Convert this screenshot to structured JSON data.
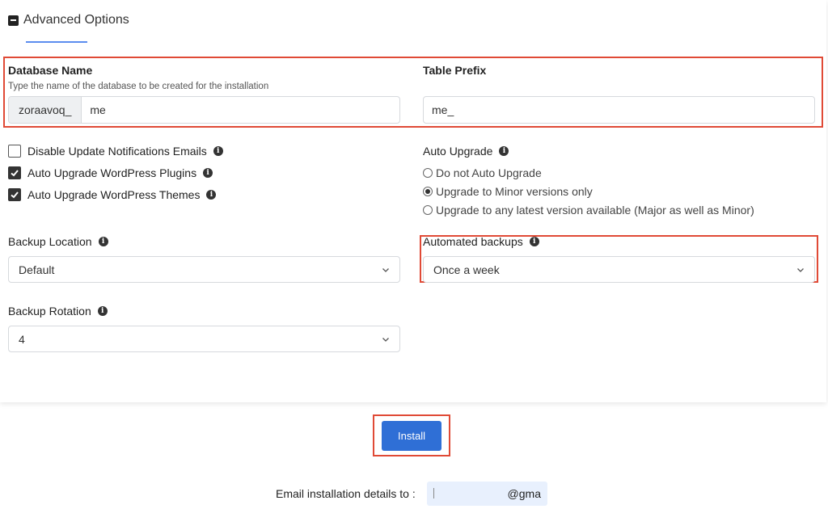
{
  "section": {
    "title": "Advanced Options"
  },
  "database": {
    "label": "Database Name",
    "help": "Type the name of the database to be created for the installation",
    "prefix": "zoraavoq_",
    "value": "me"
  },
  "table_prefix": {
    "label": "Table Prefix",
    "value": "me_"
  },
  "checkboxes": [
    {
      "label": "Disable Update Notifications Emails",
      "checked": false
    },
    {
      "label": "Auto Upgrade WordPress Plugins",
      "checked": true
    },
    {
      "label": "Auto Upgrade WordPress Themes",
      "checked": true
    }
  ],
  "auto_upgrade": {
    "label": "Auto Upgrade",
    "options": [
      {
        "label": "Do not Auto Upgrade",
        "selected": false
      },
      {
        "label": "Upgrade to Minor versions only",
        "selected": true
      },
      {
        "label": "Upgrade to any latest version available (Major as well as Minor)",
        "selected": false
      }
    ]
  },
  "backup_location": {
    "label": "Backup Location",
    "value": "Default"
  },
  "automated_backups": {
    "label": "Automated backups",
    "value": "Once a week"
  },
  "backup_rotation": {
    "label": "Backup Rotation",
    "value": "4"
  },
  "install": {
    "label": "Install"
  },
  "email": {
    "label": "Email installation details to :",
    "value": "@gma"
  },
  "colors": {
    "accent": "#2f6fd6",
    "highlight_border": "#e04a36",
    "underline": "#5b8def"
  }
}
